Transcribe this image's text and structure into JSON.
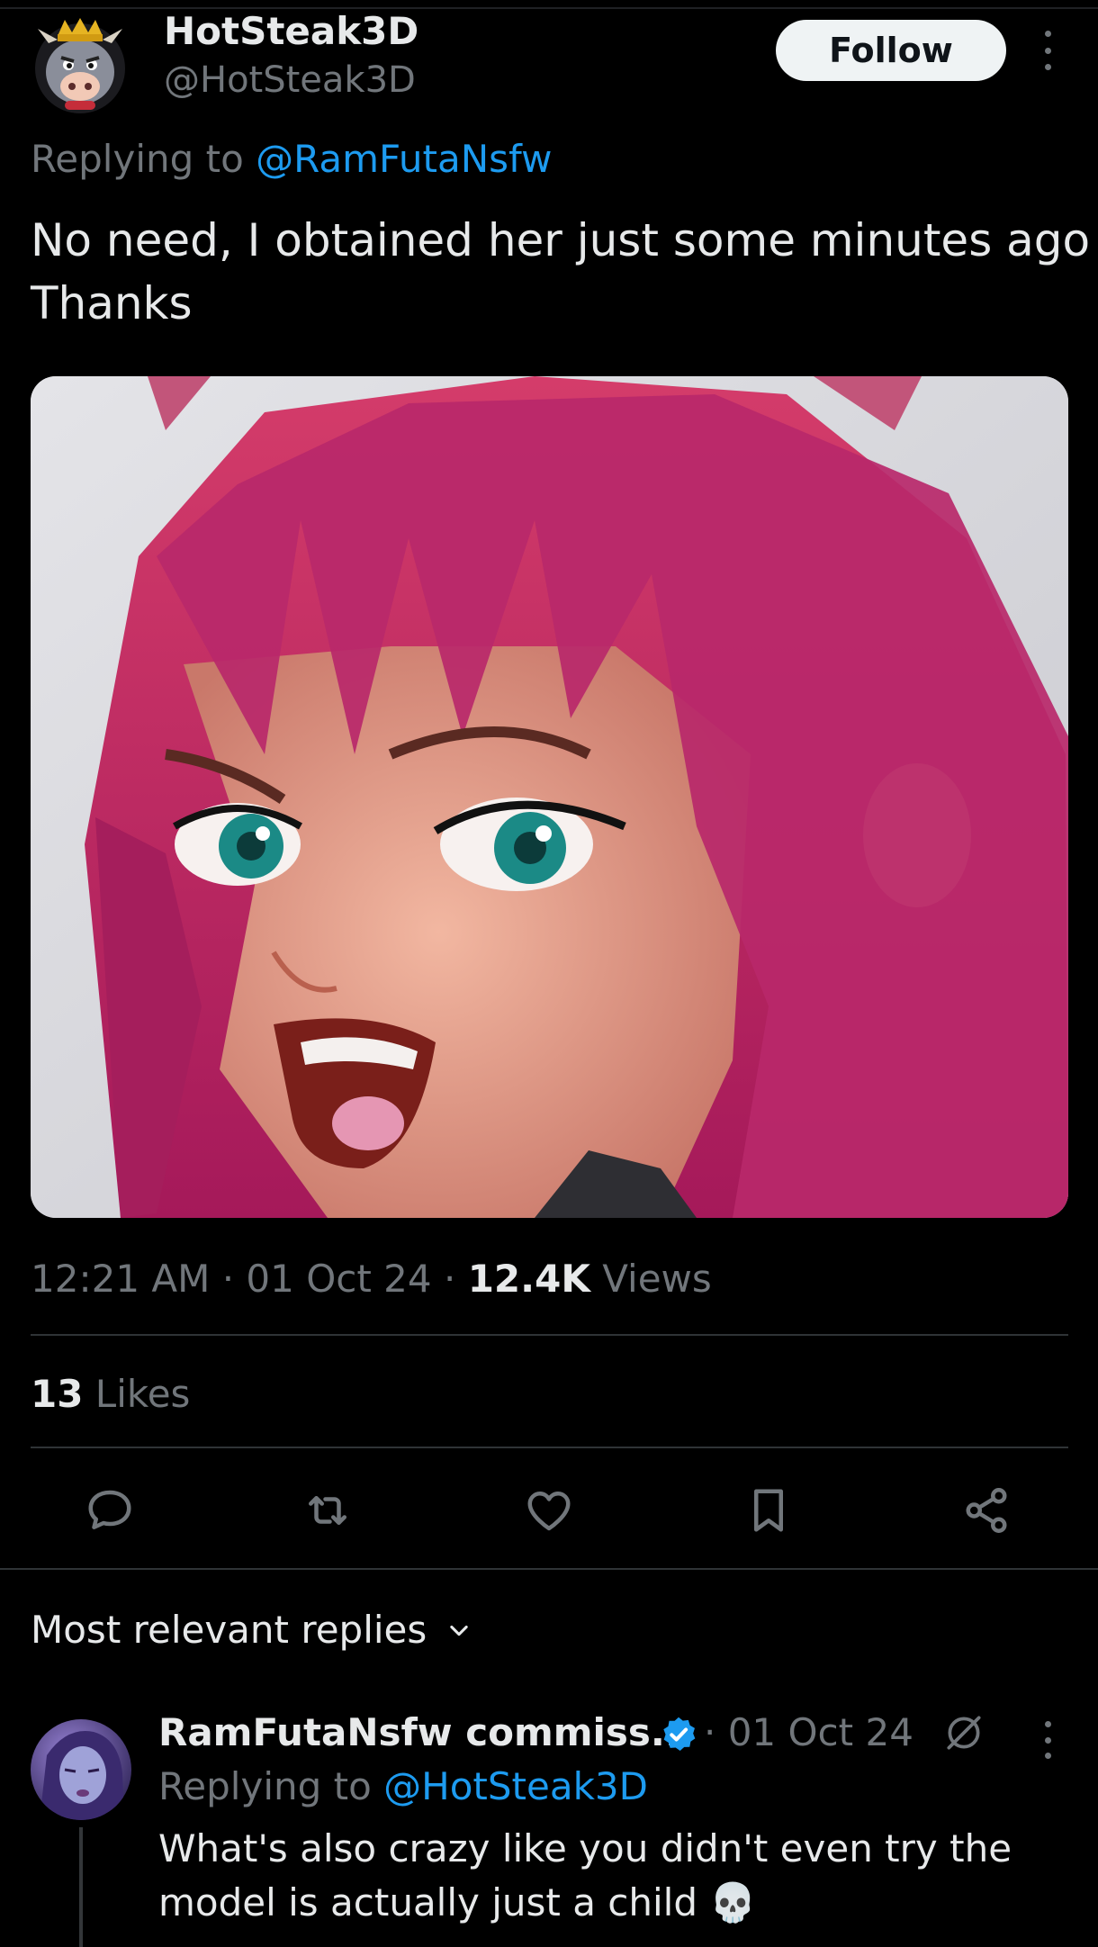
{
  "tweet": {
    "author_name": "HotSteak3D",
    "author_handle": "@HotSteak3D",
    "follow_label": "Follow",
    "replying_prefix": "Replying to ",
    "replying_mention": "@RamFutaNsfw",
    "text_lines": [
      "No need, I obtained her just some minutes ago",
      "Thanks"
    ],
    "time": "12:21 AM",
    "separator": " · ",
    "date": "01 Oct 24",
    "views_count": "12.4K",
    "views_label": " Views",
    "likes_count": "13",
    "likes_label": " Likes"
  },
  "actions": {
    "reply_icon": "reply-bubble-icon",
    "retweet_icon": "retweet-icon",
    "like_icon": "heart-icon",
    "bookmark_icon": "bookmark-icon",
    "share_icon": "share-icon"
  },
  "replies": {
    "header": "Most relevant replies",
    "items": [
      {
        "author_name": "RamFutaNsfw commiss...",
        "separator": " · ",
        "date": "01 Oct 24",
        "replying_prefix": "Replying to ",
        "replying_mention": "@HotSteak3D",
        "text_lines": [
          "What's also crazy like you didn't even try the",
          "model is actually just a child 💀"
        ]
      }
    ]
  },
  "colors": {
    "background": "#000000",
    "text_primary": "#e7e9ea",
    "text_secondary": "#71767b",
    "accent_blue": "#1d9bf0",
    "divider": "#2f3336",
    "follow_button_bg": "#eff3f4"
  }
}
